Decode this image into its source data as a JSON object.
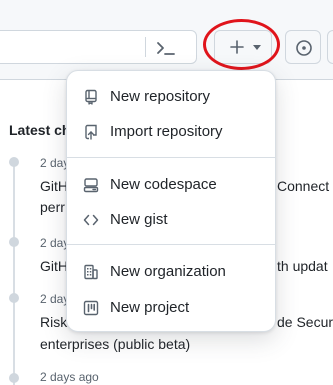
{
  "header": {
    "create_button": {
      "icon": "plus-icon",
      "caret": "triangle-down-icon"
    },
    "command_icon": "command-palette-icon",
    "issues_icon": "issue-opened-icon",
    "highlight_color": "#e0141b"
  },
  "feed": {
    "title": "Latest ch",
    "entries": [
      {
        "meta": "2 day",
        "headline_left": "GitH",
        "headline_right": "Connect",
        "second_line": "perr"
      },
      {
        "meta": "2 day",
        "headline_left": "GitH",
        "headline_right": "th updat"
      },
      {
        "meta": "2 day",
        "headline_left": "Risk",
        "headline_right": "de Secur",
        "second_line": "enterprises (public beta)"
      },
      {
        "meta": "2 days ago"
      }
    ]
  },
  "create_menu": {
    "items": [
      {
        "label": "New repository",
        "icon": "repo-icon"
      },
      {
        "label": "Import repository",
        "icon": "repo-push-icon"
      },
      {
        "label": "New codespace",
        "icon": "codespaces-icon"
      },
      {
        "label": "New gist",
        "icon": "code-icon"
      },
      {
        "label": "New organization",
        "icon": "organization-icon"
      },
      {
        "label": "New project",
        "icon": "project-icon"
      }
    ]
  }
}
